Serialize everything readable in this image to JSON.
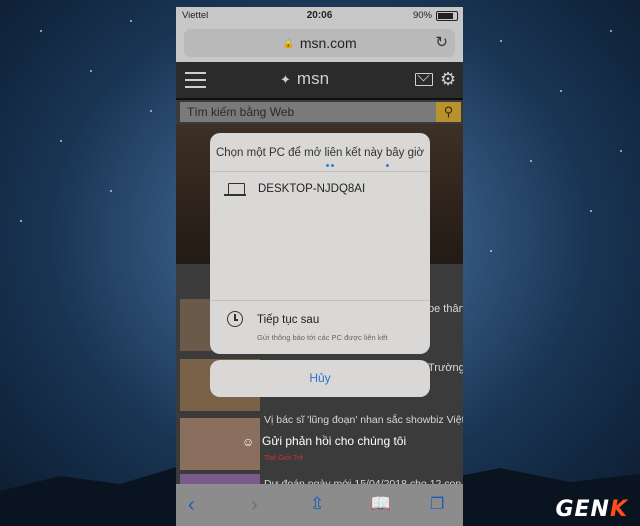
{
  "status_bar": {
    "carrier": "Viettel",
    "time": "20:06",
    "battery": "90%"
  },
  "browser": {
    "url": "msn.com"
  },
  "msn_header": {
    "logo_text": "msn"
  },
  "search": {
    "placeholder": "Tìm kiếm bằng Web"
  },
  "news_peek": [
    {
      "title_fragment": "pe thân"
    },
    {
      "title_fragment": "Trường"
    },
    {
      "title": "Vị bác sĩ 'lũng đoạn' nhan sắc showbiz Việt",
      "source": "Thế Giới Trẻ"
    },
    {
      "title": "Dự đoán ngày mới 15/04/2018 cho 12 con"
    }
  ],
  "action_sheet": {
    "title": "Chọn một PC để mở liên kết này bây giờ",
    "device_name": "DESKTOP-NJDQ8AI",
    "later_label": "Tiếp tục sau",
    "later_subtitle": "Gửi thông báo tới các PC được liên kết",
    "cancel_label": "Hủy"
  },
  "feedback_label": "Gửi phản hồi cho chúng tôi",
  "watermark": {
    "text_main": "GEN",
    "text_accent": "K"
  }
}
